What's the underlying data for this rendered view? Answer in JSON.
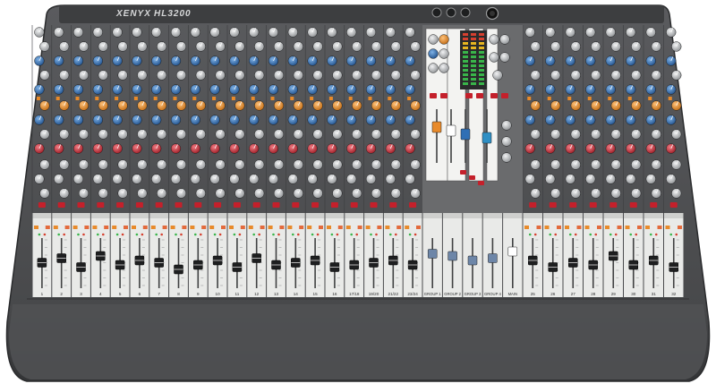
{
  "product": {
    "brand": "XENYX",
    "model": "HL3200"
  },
  "colors": {
    "chassis": "#4a4b4d",
    "chassis_edge": "#2e2f31",
    "panel": "#5d5e60",
    "strip_bg": "#e9eae8",
    "knob_gray": "#b9bcbf",
    "knob_blue": "#2f6fb5",
    "knob_orange": "#e88a2a",
    "knob_red": "#c8313b",
    "button_red": "#c4202b",
    "fader_cap": "#1e1f20",
    "meter_green": "#39b54a"
  },
  "input_channels": {
    "left_labels": [
      "1",
      "2",
      "3",
      "4",
      "5",
      "6",
      "7",
      "8",
      "9",
      "10",
      "11",
      "12",
      "13",
      "14",
      "15",
      "16",
      "17/18",
      "19/20",
      "21/22",
      "23/24"
    ],
    "right_labels": [
      "25",
      "26",
      "27",
      "28",
      "29",
      "30",
      "31",
      "32"
    ],
    "fader_levels_left": [
      0.55,
      0.65,
      0.45,
      0.7,
      0.5,
      0.6,
      0.55,
      0.4,
      0.5,
      0.6,
      0.45,
      0.65,
      0.5,
      0.55,
      0.6,
      0.45,
      0.5,
      0.55,
      0.6,
      0.5
    ],
    "fader_levels_right": [
      0.6,
      0.45,
      0.55,
      0.5,
      0.7,
      0.5,
      0.6,
      0.45
    ]
  },
  "master_section": {
    "labels": [
      "GROUP 1",
      "GROUP 2",
      "GROUP 3",
      "GROUP 4",
      "MAIN"
    ],
    "fader_levels": [
      0.75,
      0.7,
      0.6,
      0.65,
      0.8
    ]
  }
}
